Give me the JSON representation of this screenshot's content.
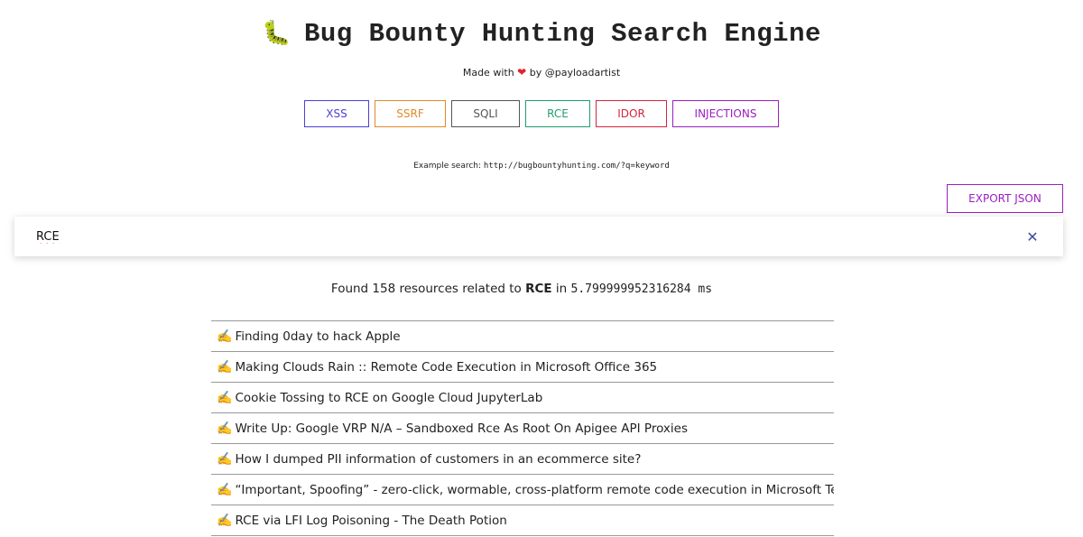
{
  "header": {
    "icon": "caterpillar-icon",
    "bug_glyph": "🐛",
    "title": "Bug Bounty Hunting Search Engine",
    "made_with_prefix": "Made with",
    "heart": "❤",
    "made_with_suffix": "by @payloadartist"
  },
  "filters": [
    {
      "label": "XSS",
      "color": "#4b3fd6",
      "width": 72
    },
    {
      "label": "SSRF",
      "color": "#e08a2a",
      "width": 79
    },
    {
      "label": "SQLI",
      "color": "#555555",
      "width": 76
    },
    {
      "label": "RCE",
      "color": "#1f9e6e",
      "width": 72
    },
    {
      "label": "IDOR",
      "color": "#d6243f",
      "width": 79
    },
    {
      "label": "INJECTIONS",
      "color": "#9b1fbf",
      "width": 118
    }
  ],
  "example": {
    "label": "Example search:",
    "url": "http://bugbountyhunting.com/?q=keyword"
  },
  "export_label": "EXPORT JSON",
  "search": {
    "value": "RCE",
    "clear_glyph": "✕"
  },
  "summary": {
    "prefix": "Found 158 resources related to",
    "term": "RCE",
    "mid": "in",
    "time": "5.799999952316284 ms"
  },
  "results": [
    {
      "icon": "✍️",
      "title": "Finding 0day to hack Apple"
    },
    {
      "icon": "✍️",
      "title": "Making Clouds Rain :: Remote Code Execution in Microsoft Office 365"
    },
    {
      "icon": "✍️",
      "title": "Cookie Tossing to RCE on Google Cloud JupyterLab"
    },
    {
      "icon": "✍️",
      "title": "Write Up: Google VRP N/A – Sandboxed Rce As Root On Apigee API Proxies"
    },
    {
      "icon": "✍️",
      "title": "How I dumped PII information of customers in an ecommerce site?"
    },
    {
      "icon": "✍️",
      "title": "“Important, Spoofing” - zero-click, wormable, cross-platform remote code execution in Microsoft Teams"
    },
    {
      "icon": "✍️",
      "title": "RCE via LFI Log Poisoning - The Death Potion"
    }
  ]
}
